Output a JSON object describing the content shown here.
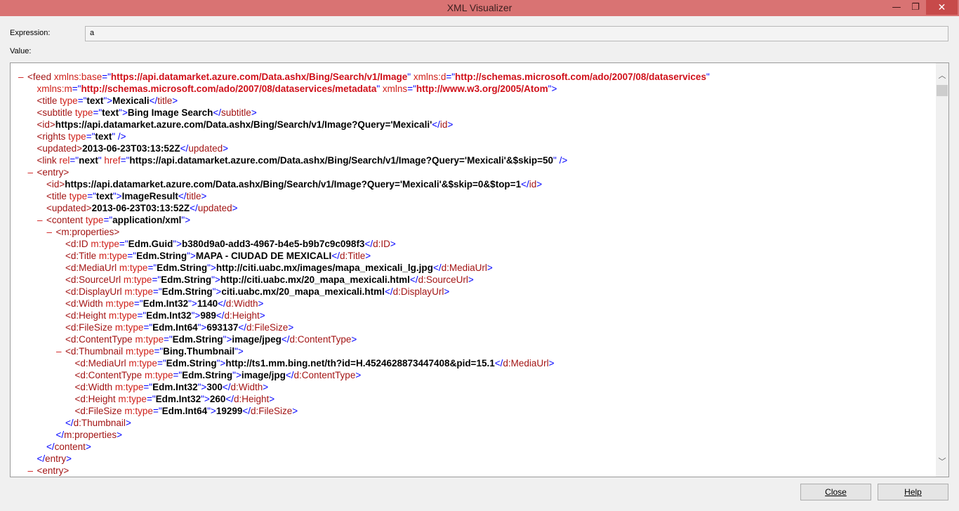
{
  "window": {
    "title": "XML Visualizer",
    "min_glyph": "—",
    "max_glyph": "❐",
    "close_glyph": "✕"
  },
  "expression": {
    "label": "Expression:",
    "value": "a"
  },
  "value": {
    "label": "Value:"
  },
  "xml_lines": [
    {
      "indent": 0,
      "marker": "–",
      "segs": [
        [
          "t",
          "<feed "
        ],
        [
          "an",
          "xmlns:base"
        ],
        [
          "b",
          "=\""
        ],
        [
          "avr",
          "https://api.datamarket.azure.com/Data.ashx/Bing/Search/v1/Image"
        ],
        [
          "b",
          "\" "
        ],
        [
          "an",
          "xmlns:d"
        ],
        [
          "b",
          "=\""
        ],
        [
          "avr",
          "http://schemas.microsoft.com/ado/2007/08/dataservices"
        ],
        [
          "b",
          "\""
        ]
      ]
    },
    {
      "indent": 1,
      "marker": "",
      "segs": [
        [
          "an",
          "xmlns:m"
        ],
        [
          "b",
          "=\""
        ],
        [
          "avr",
          "http://schemas.microsoft.com/ado/2007/08/dataservices/metadata"
        ],
        [
          "b",
          "\" "
        ],
        [
          "an",
          "xmlns"
        ],
        [
          "b",
          "=\""
        ],
        [
          "avr",
          "http://www.w3.org/2005/Atom"
        ],
        [
          "b",
          "\">"
        ]
      ]
    },
    {
      "indent": 1,
      "marker": "",
      "segs": [
        [
          "t",
          "<title "
        ],
        [
          "an",
          "type"
        ],
        [
          "b",
          "=\""
        ],
        [
          "av",
          "text"
        ],
        [
          "b",
          "\">"
        ],
        [
          "tx",
          "Mexicali"
        ],
        [
          "b",
          "</"
        ],
        [
          "t",
          "title"
        ],
        [
          "b",
          ">"
        ]
      ]
    },
    {
      "indent": 1,
      "marker": "",
      "segs": [
        [
          "t",
          "<subtitle "
        ],
        [
          "an",
          "type"
        ],
        [
          "b",
          "=\""
        ],
        [
          "av",
          "text"
        ],
        [
          "b",
          "\">"
        ],
        [
          "tx",
          "Bing Image Search"
        ],
        [
          "b",
          "</"
        ],
        [
          "t",
          "subtitle"
        ],
        [
          "b",
          ">"
        ]
      ]
    },
    {
      "indent": 1,
      "marker": "",
      "segs": [
        [
          "t",
          "<id>"
        ],
        [
          "tx",
          "https://api.datamarket.azure.com/Data.ashx/Bing/Search/v1/Image?Query='Mexicali'"
        ],
        [
          "b",
          "</"
        ],
        [
          "t",
          "id"
        ],
        [
          "b",
          ">"
        ]
      ]
    },
    {
      "indent": 1,
      "marker": "",
      "segs": [
        [
          "t",
          "<rights "
        ],
        [
          "an",
          "type"
        ],
        [
          "b",
          "=\""
        ],
        [
          "av",
          "text"
        ],
        [
          "b",
          "\" />"
        ]
      ]
    },
    {
      "indent": 1,
      "marker": "",
      "segs": [
        [
          "t",
          "<updated>"
        ],
        [
          "tx",
          "2013-06-23T03:13:52Z"
        ],
        [
          "b",
          "</"
        ],
        [
          "t",
          "updated"
        ],
        [
          "b",
          ">"
        ]
      ]
    },
    {
      "indent": 1,
      "marker": "",
      "segs": [
        [
          "t",
          "<link "
        ],
        [
          "an",
          "rel"
        ],
        [
          "b",
          "=\""
        ],
        [
          "av",
          "next"
        ],
        [
          "b",
          "\" "
        ],
        [
          "an",
          "href"
        ],
        [
          "b",
          "=\""
        ],
        [
          "av",
          "https://api.datamarket.azure.com/Data.ashx/Bing/Search/v1/Image?Query='Mexicali'&$skip=50"
        ],
        [
          "b",
          "\" />"
        ]
      ]
    },
    {
      "indent": 1,
      "marker": "–",
      "segs": [
        [
          "t",
          "<entry>"
        ]
      ]
    },
    {
      "indent": 2,
      "marker": "",
      "segs": [
        [
          "t",
          "<id>"
        ],
        [
          "tx",
          "https://api.datamarket.azure.com/Data.ashx/Bing/Search/v1/Image?Query='Mexicali'&$skip=0&$top=1"
        ],
        [
          "b",
          "</"
        ],
        [
          "t",
          "id"
        ],
        [
          "b",
          ">"
        ]
      ]
    },
    {
      "indent": 2,
      "marker": "",
      "segs": [
        [
          "t",
          "<title "
        ],
        [
          "an",
          "type"
        ],
        [
          "b",
          "=\""
        ],
        [
          "av",
          "text"
        ],
        [
          "b",
          "\">"
        ],
        [
          "tx",
          "ImageResult"
        ],
        [
          "b",
          "</"
        ],
        [
          "t",
          "title"
        ],
        [
          "b",
          ">"
        ]
      ]
    },
    {
      "indent": 2,
      "marker": "",
      "segs": [
        [
          "t",
          "<updated>"
        ],
        [
          "tx",
          "2013-06-23T03:13:52Z"
        ],
        [
          "b",
          "</"
        ],
        [
          "t",
          "updated"
        ],
        [
          "b",
          ">"
        ]
      ]
    },
    {
      "indent": 2,
      "marker": "–",
      "segs": [
        [
          "t",
          "<content "
        ],
        [
          "an",
          "type"
        ],
        [
          "b",
          "=\""
        ],
        [
          "av",
          "application/xml"
        ],
        [
          "b",
          "\">"
        ]
      ]
    },
    {
      "indent": 3,
      "marker": "–",
      "segs": [
        [
          "t",
          "<m:properties>"
        ]
      ]
    },
    {
      "indent": 4,
      "marker": "",
      "segs": [
        [
          "t",
          "<d:ID "
        ],
        [
          "an",
          "m:type"
        ],
        [
          "b",
          "=\""
        ],
        [
          "av",
          "Edm.Guid"
        ],
        [
          "b",
          "\">"
        ],
        [
          "tx",
          "b380d9a0-add3-4967-b4e5-b9b7c9c098f3"
        ],
        [
          "b",
          "</"
        ],
        [
          "t",
          "d:ID"
        ],
        [
          "b",
          ">"
        ]
      ]
    },
    {
      "indent": 4,
      "marker": "",
      "segs": [
        [
          "t",
          "<d:Title "
        ],
        [
          "an",
          "m:type"
        ],
        [
          "b",
          "=\""
        ],
        [
          "av",
          "Edm.String"
        ],
        [
          "b",
          "\">"
        ],
        [
          "tx",
          "MAPA - CIUDAD DE MEXICALI"
        ],
        [
          "b",
          "</"
        ],
        [
          "t",
          "d:Title"
        ],
        [
          "b",
          ">"
        ]
      ]
    },
    {
      "indent": 4,
      "marker": "",
      "segs": [
        [
          "t",
          "<d:MediaUrl "
        ],
        [
          "an",
          "m:type"
        ],
        [
          "b",
          "=\""
        ],
        [
          "av",
          "Edm.String"
        ],
        [
          "b",
          "\">"
        ],
        [
          "tx",
          "http://citi.uabc.mx/images/mapa_mexicali_lg.jpg"
        ],
        [
          "b",
          "</"
        ],
        [
          "t",
          "d:MediaUrl"
        ],
        [
          "b",
          ">"
        ]
      ]
    },
    {
      "indent": 4,
      "marker": "",
      "segs": [
        [
          "t",
          "<d:SourceUrl "
        ],
        [
          "an",
          "m:type"
        ],
        [
          "b",
          "=\""
        ],
        [
          "av",
          "Edm.String"
        ],
        [
          "b",
          "\">"
        ],
        [
          "tx",
          "http://citi.uabc.mx/20_mapa_mexicali.html"
        ],
        [
          "b",
          "</"
        ],
        [
          "t",
          "d:SourceUrl"
        ],
        [
          "b",
          ">"
        ]
      ]
    },
    {
      "indent": 4,
      "marker": "",
      "segs": [
        [
          "t",
          "<d:DisplayUrl "
        ],
        [
          "an",
          "m:type"
        ],
        [
          "b",
          "=\""
        ],
        [
          "av",
          "Edm.String"
        ],
        [
          "b",
          "\">"
        ],
        [
          "tx",
          "citi.uabc.mx/20_mapa_mexicali.html"
        ],
        [
          "b",
          "</"
        ],
        [
          "t",
          "d:DisplayUrl"
        ],
        [
          "b",
          ">"
        ]
      ]
    },
    {
      "indent": 4,
      "marker": "",
      "segs": [
        [
          "t",
          "<d:Width "
        ],
        [
          "an",
          "m:type"
        ],
        [
          "b",
          "=\""
        ],
        [
          "av",
          "Edm.Int32"
        ],
        [
          "b",
          "\">"
        ],
        [
          "tx",
          "1140"
        ],
        [
          "b",
          "</"
        ],
        [
          "t",
          "d:Width"
        ],
        [
          "b",
          ">"
        ]
      ]
    },
    {
      "indent": 4,
      "marker": "",
      "segs": [
        [
          "t",
          "<d:Height "
        ],
        [
          "an",
          "m:type"
        ],
        [
          "b",
          "=\""
        ],
        [
          "av",
          "Edm.Int32"
        ],
        [
          "b",
          "\">"
        ],
        [
          "tx",
          "989"
        ],
        [
          "b",
          "</"
        ],
        [
          "t",
          "d:Height"
        ],
        [
          "b",
          ">"
        ]
      ]
    },
    {
      "indent": 4,
      "marker": "",
      "segs": [
        [
          "t",
          "<d:FileSize "
        ],
        [
          "an",
          "m:type"
        ],
        [
          "b",
          "=\""
        ],
        [
          "av",
          "Edm.Int64"
        ],
        [
          "b",
          "\">"
        ],
        [
          "tx",
          "693137"
        ],
        [
          "b",
          "</"
        ],
        [
          "t",
          "d:FileSize"
        ],
        [
          "b",
          ">"
        ]
      ]
    },
    {
      "indent": 4,
      "marker": "",
      "segs": [
        [
          "t",
          "<d:ContentType "
        ],
        [
          "an",
          "m:type"
        ],
        [
          "b",
          "=\""
        ],
        [
          "av",
          "Edm.String"
        ],
        [
          "b",
          "\">"
        ],
        [
          "tx",
          "image/jpeg"
        ],
        [
          "b",
          "</"
        ],
        [
          "t",
          "d:ContentType"
        ],
        [
          "b",
          ">"
        ]
      ]
    },
    {
      "indent": 4,
      "marker": "–",
      "segs": [
        [
          "t",
          "<d:Thumbnail "
        ],
        [
          "an",
          "m:type"
        ],
        [
          "b",
          "=\""
        ],
        [
          "av",
          "Bing.Thumbnail"
        ],
        [
          "b",
          "\">"
        ]
      ]
    },
    {
      "indent": 5,
      "marker": "",
      "segs": [
        [
          "t",
          "<d:MediaUrl "
        ],
        [
          "an",
          "m:type"
        ],
        [
          "b",
          "=\""
        ],
        [
          "av",
          "Edm.String"
        ],
        [
          "b",
          "\">"
        ],
        [
          "tx",
          "http://ts1.mm.bing.net/th?id=H.4524628873447408&pid=15.1"
        ],
        [
          "b",
          "</"
        ],
        [
          "t",
          "d:MediaUrl"
        ],
        [
          "b",
          ">"
        ]
      ]
    },
    {
      "indent": 5,
      "marker": "",
      "segs": [
        [
          "t",
          "<d:ContentType "
        ],
        [
          "an",
          "m:type"
        ],
        [
          "b",
          "=\""
        ],
        [
          "av",
          "Edm.String"
        ],
        [
          "b",
          "\">"
        ],
        [
          "tx",
          "image/jpg"
        ],
        [
          "b",
          "</"
        ],
        [
          "t",
          "d:ContentType"
        ],
        [
          "b",
          ">"
        ]
      ]
    },
    {
      "indent": 5,
      "marker": "",
      "segs": [
        [
          "t",
          "<d:Width "
        ],
        [
          "an",
          "m:type"
        ],
        [
          "b",
          "=\""
        ],
        [
          "av",
          "Edm.Int32"
        ],
        [
          "b",
          "\">"
        ],
        [
          "tx",
          "300"
        ],
        [
          "b",
          "</"
        ],
        [
          "t",
          "d:Width"
        ],
        [
          "b",
          ">"
        ]
      ]
    },
    {
      "indent": 5,
      "marker": "",
      "segs": [
        [
          "t",
          "<d:Height "
        ],
        [
          "an",
          "m:type"
        ],
        [
          "b",
          "=\""
        ],
        [
          "av",
          "Edm.Int32"
        ],
        [
          "b",
          "\">"
        ],
        [
          "tx",
          "260"
        ],
        [
          "b",
          "</"
        ],
        [
          "t",
          "d:Height"
        ],
        [
          "b",
          ">"
        ]
      ]
    },
    {
      "indent": 5,
      "marker": "",
      "segs": [
        [
          "t",
          "<d:FileSize "
        ],
        [
          "an",
          "m:type"
        ],
        [
          "b",
          "=\""
        ],
        [
          "av",
          "Edm.Int64"
        ],
        [
          "b",
          "\">"
        ],
        [
          "tx",
          "19299"
        ],
        [
          "b",
          "</"
        ],
        [
          "t",
          "d:FileSize"
        ],
        [
          "b",
          ">"
        ]
      ]
    },
    {
      "indent": 4,
      "marker": "",
      "segs": [
        [
          "b",
          "</"
        ],
        [
          "t",
          "d:Thumbnail"
        ],
        [
          "b",
          ">"
        ]
      ]
    },
    {
      "indent": 3,
      "marker": "",
      "segs": [
        [
          "b",
          "</"
        ],
        [
          "t",
          "m:properties"
        ],
        [
          "b",
          ">"
        ]
      ]
    },
    {
      "indent": 2,
      "marker": "",
      "segs": [
        [
          "b",
          "</"
        ],
        [
          "t",
          "content"
        ],
        [
          "b",
          ">"
        ]
      ]
    },
    {
      "indent": 1,
      "marker": "",
      "segs": [
        [
          "b",
          "</"
        ],
        [
          "t",
          "entry"
        ],
        [
          "b",
          ">"
        ]
      ]
    },
    {
      "indent": 1,
      "marker": "–",
      "segs": [
        [
          "t",
          "<entry>"
        ]
      ]
    }
  ],
  "scrollbar": {
    "up_icon": "up-arrow-icon",
    "down_icon": "down-arrow-icon",
    "up_glyph": "︿",
    "down_glyph": "﹀"
  },
  "buttons": {
    "close": "Close",
    "help": "Help"
  }
}
